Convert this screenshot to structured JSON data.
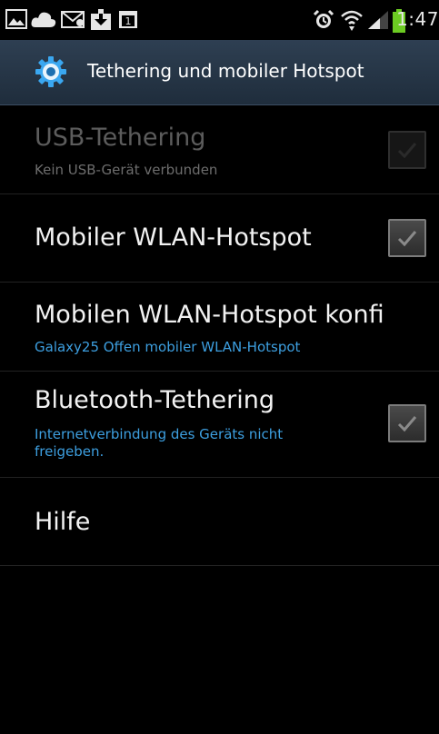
{
  "status_bar": {
    "time": "1:47",
    "left_icons": [
      "gallery-icon",
      "cloud-icon",
      "mail-icon",
      "download-icon",
      "calendar-icon"
    ],
    "calendar_day": "1",
    "right_icons": [
      "alarm-icon",
      "wifi-icon",
      "signal-icon",
      "battery-icon"
    ],
    "battery_color": "#6ccb22"
  },
  "action_bar": {
    "icon": "gear-icon",
    "title": "Tethering und mobiler Hotspot"
  },
  "settings": {
    "usb": {
      "title": "USB-Tethering",
      "summary": "Kein USB-Gerät verbunden",
      "checked": false,
      "enabled": false
    },
    "hotspot": {
      "title": "Mobiler WLAN-Hotspot",
      "checked": false
    },
    "configure": {
      "title": "Mobilen WLAN-Hotspot konfi",
      "summary": "Galaxy25 Offen mobiler WLAN-Hotspot"
    },
    "bluetooth": {
      "title": "Bluetooth-Tethering",
      "summary_line1": "Internetverbindung des Geräts nicht",
      "summary_line2": "freigeben.",
      "checked": false
    },
    "help": {
      "title": "Hilfe"
    }
  },
  "colors": {
    "action_bar": "#26374a",
    "summary_blue": "#3d9fe0",
    "summary_grey": "#6d6d6d",
    "disabled_title": "#5c5c5c"
  }
}
